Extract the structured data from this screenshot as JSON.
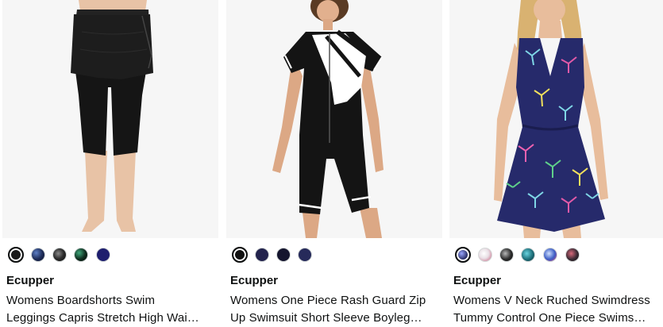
{
  "products": [
    {
      "image_alt": "Black skirted capri swim leggings",
      "brand": "Ecupper",
      "title_line1": "Womens Boardshorts Swim",
      "title_line2": "Leggings Capris Stretch High Wai…",
      "swatches": [
        {
          "color": "#1a1a1a",
          "selected": true,
          "pattern": "solid"
        },
        {
          "color": "#1c2a55",
          "selected": false,
          "pattern": "print"
        },
        {
          "color": "#2b2b2b",
          "selected": false,
          "pattern": "print"
        },
        {
          "color": "#0d2a1c",
          "selected": false,
          "pattern": "print"
        },
        {
          "color": "#1e1e6e",
          "selected": false,
          "pattern": "solid"
        }
      ]
    },
    {
      "image_alt": "Black and white one piece rash guard zip swimsuit",
      "brand": "Ecupper",
      "title_line1": "Womens One Piece Rash Guard Zip",
      "title_line2": "Up Swimsuit Short Sleeve Boyleg…",
      "swatches": [
        {
          "color": "#111111",
          "selected": true,
          "pattern": "solid"
        },
        {
          "color": "#23234d",
          "selected": false,
          "pattern": "solid"
        },
        {
          "color": "#15152e",
          "selected": false,
          "pattern": "solid"
        },
        {
          "color": "#262a5a",
          "selected": false,
          "pattern": "solid"
        }
      ]
    },
    {
      "image_alt": "Navy floral palm print V neck swimdress",
      "brand": "Ecupper",
      "title_line1": "Womens V Neck Ruched Swimdress",
      "title_line2": "Tummy Control One Piece Swims…",
      "swatches": [
        {
          "color": "#2a2f66",
          "selected": true,
          "pattern": "print"
        },
        {
          "color": "#e9e0e6",
          "selected": false,
          "pattern": "print"
        },
        {
          "color": "#2a2a2a",
          "selected": false,
          "pattern": "print"
        },
        {
          "color": "#1e6f7a",
          "selected": false,
          "pattern": "print"
        },
        {
          "color": "#3b5cc4",
          "selected": false,
          "pattern": "print"
        },
        {
          "color": "#3a2a34",
          "selected": false,
          "pattern": "print"
        }
      ]
    }
  ]
}
